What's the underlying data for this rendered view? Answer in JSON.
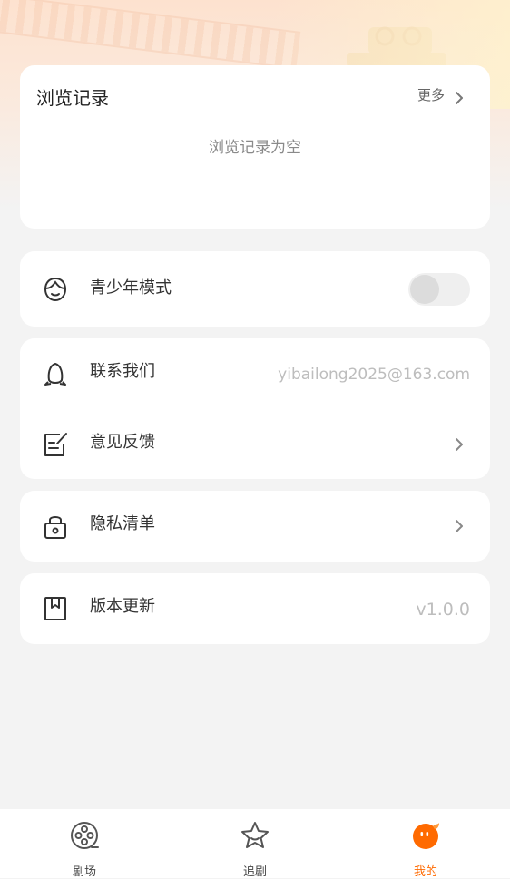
{
  "history": {
    "title": "浏览记录",
    "more": "更多",
    "empty": "浏览记录为空"
  },
  "settings": {
    "youth_mode": "青少年模式",
    "youth_mode_enabled": false,
    "contact": {
      "label": "联系我们",
      "value": "yibailong2025@163.com"
    },
    "feedback": "意见反馈",
    "privacy": "隐私清单",
    "version": {
      "label": "版本更新",
      "value": "v1.0.0"
    }
  },
  "tabs": [
    {
      "label": "剧场",
      "icon": "film-reel-icon",
      "active": false
    },
    {
      "label": "追剧",
      "icon": "star-icon",
      "active": false
    },
    {
      "label": "我的",
      "icon": "profile-face-icon",
      "active": true
    }
  ],
  "colors": {
    "accent": "#ff6a00",
    "background": "#f3f3f3",
    "card": "#ffffff"
  }
}
